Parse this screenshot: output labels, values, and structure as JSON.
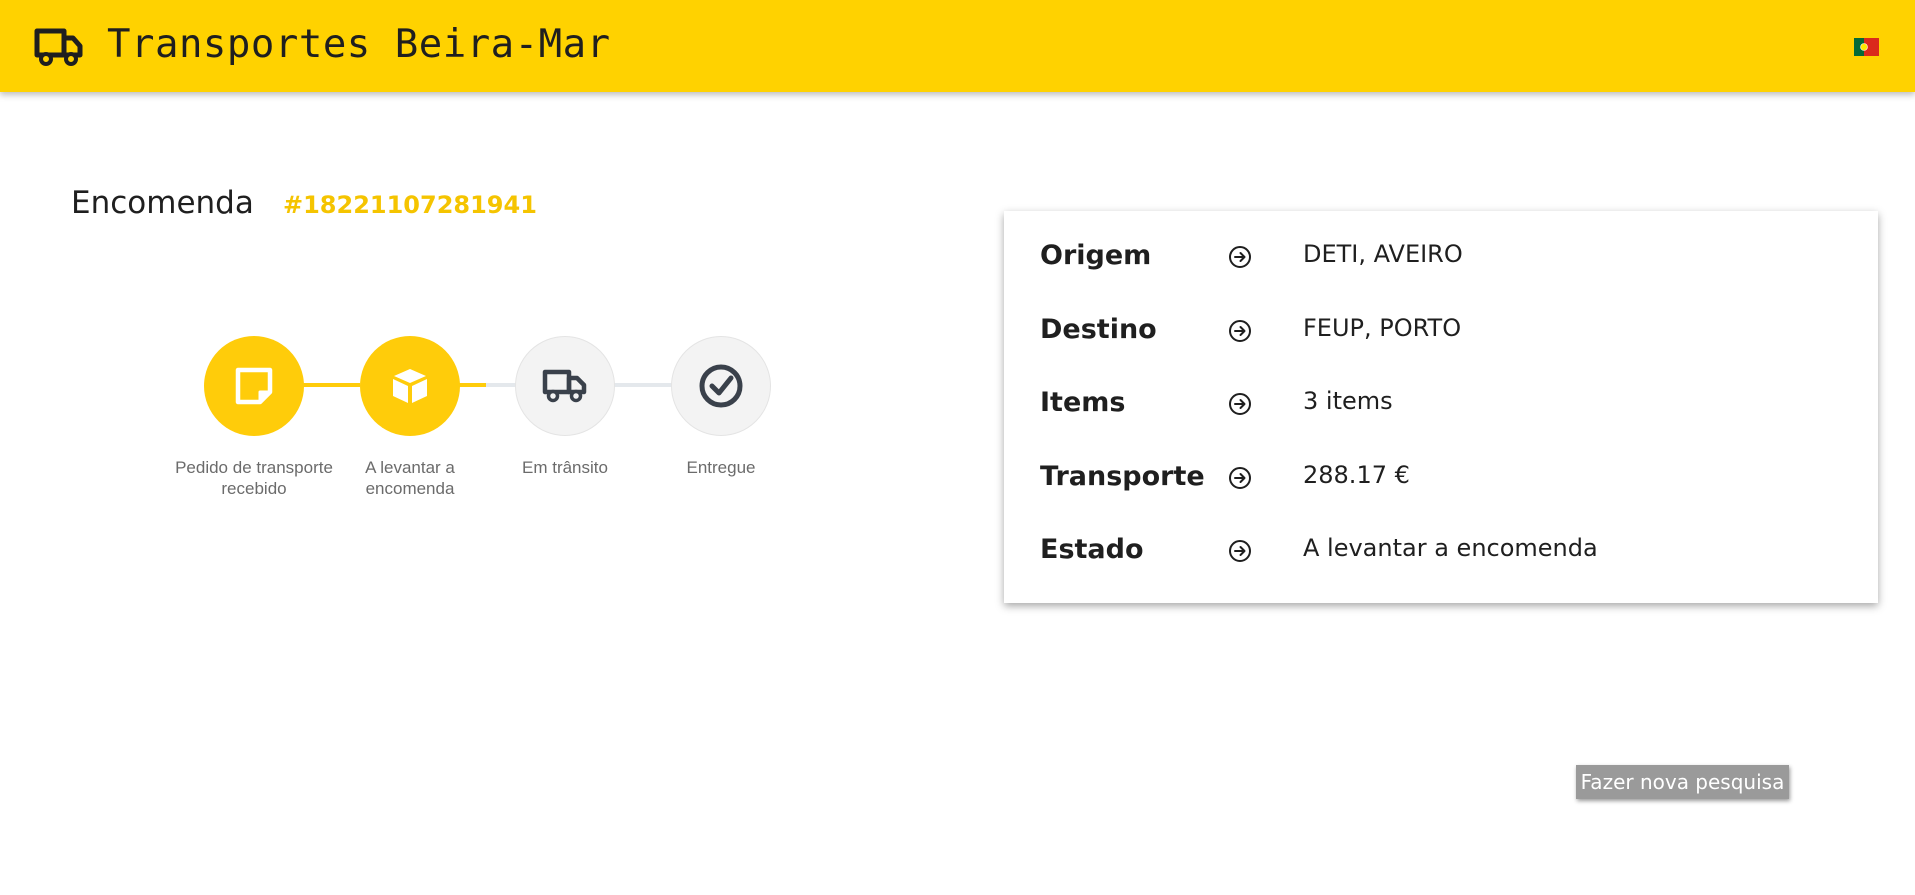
{
  "header": {
    "title": "Transportes Beira-Mar",
    "logo_icon": "truck-icon",
    "language_icon": "portugal-flag-icon",
    "bg_color": "#ffd200"
  },
  "order": {
    "label": "Encomenda",
    "number": "#18221107281941",
    "accent_color": "#f5c400"
  },
  "progress": {
    "current_step": 2,
    "total_steps": 4,
    "steps": [
      {
        "label": "Pedido de transporte recebido",
        "icon": "note-icon",
        "done": true
      },
      {
        "label": "A levantar a encomenda",
        "icon": "package-icon",
        "done": true
      },
      {
        "label": "Em trânsito",
        "icon": "truck-icon",
        "done": false
      },
      {
        "label": "Entregue",
        "icon": "check-circle-icon",
        "done": false
      }
    ]
  },
  "details": {
    "rows": [
      {
        "key": "Origem",
        "value": "DETI, AVEIRO",
        "icon": "arrow-circle-right-icon"
      },
      {
        "key": "Destino",
        "value": "FEUP, PORTO",
        "icon": "arrow-circle-right-icon"
      },
      {
        "key": "Items",
        "value": "3 items",
        "icon": "arrow-circle-right-icon"
      },
      {
        "key": "Transporte",
        "value": "288.17 €",
        "icon": "arrow-circle-right-icon"
      },
      {
        "key": "Estado",
        "value": "A levantar a encomenda",
        "icon": "arrow-circle-right-icon"
      }
    ]
  },
  "actions": {
    "new_search_label": "Fazer nova pesquisa"
  }
}
